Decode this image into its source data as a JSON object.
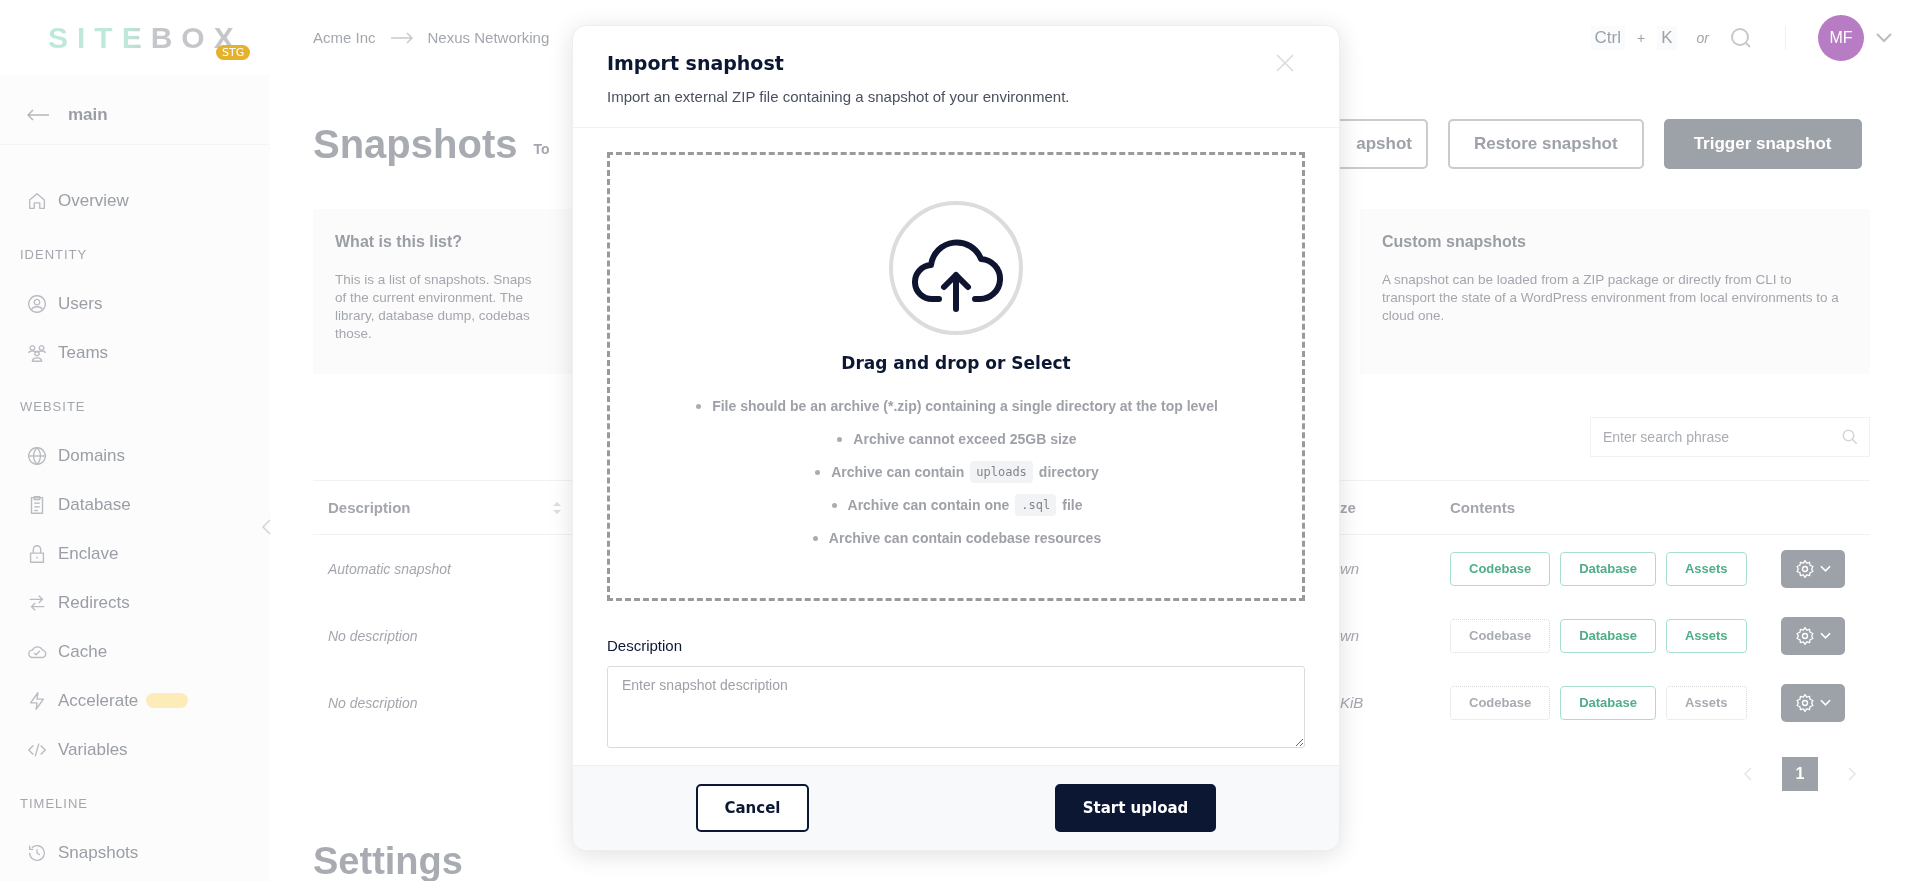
{
  "header": {
    "logo": "SITEBOX",
    "env_badge": "STG",
    "breadcrumbs": [
      "Acme Inc",
      "Nexus Networking"
    ],
    "shortcut": {
      "keys": [
        "Ctrl",
        "K"
      ],
      "plus": "+",
      "or": "or"
    },
    "avatar": "MF"
  },
  "sidebar": {
    "back": "main",
    "sections": [
      {
        "items": [
          {
            "label": "Overview"
          }
        ]
      },
      {
        "heading": "IDENTITY",
        "items": [
          {
            "label": "Users"
          },
          {
            "label": "Teams"
          }
        ]
      },
      {
        "heading": "WEBSITE",
        "items": [
          {
            "label": "Domains"
          },
          {
            "label": "Database"
          },
          {
            "label": "Enclave"
          },
          {
            "label": "Redirects"
          },
          {
            "label": "Cache"
          },
          {
            "label": "Accelerate",
            "badge": true
          },
          {
            "label": "Variables"
          }
        ]
      },
      {
        "heading": "TIMELINE",
        "items": [
          {
            "label": "Snapshots"
          }
        ]
      }
    ]
  },
  "page": {
    "title": "Snapshots",
    "title_suffix": "To",
    "actions": [
      {
        "label": "apshot",
        "kind": "outline"
      },
      {
        "label": "Restore snapshot",
        "kind": "outline"
      },
      {
        "label": "Trigger snapshot",
        "kind": "primary"
      }
    ],
    "info_card": {
      "title": "What is this list?",
      "lines": [
        "This is a list of snapshots. Snaps",
        "of the current environment. The",
        "library, database dump, codebas",
        "those."
      ]
    },
    "custom_card": {
      "title": "Custom snapshots",
      "text": "A snapshot can be loaded from a ZIP package or directly from CLI to transport the state of a WordPress environment from local environments to a cloud one."
    },
    "search": {
      "placeholder": "Enter search phrase"
    },
    "table": {
      "columns": [
        "Description",
        "ze",
        "Contents"
      ],
      "rows": [
        {
          "description": "Automatic snapshot",
          "size": "wn",
          "contents": [
            {
              "label": "Codebase",
              "included": true
            },
            {
              "label": "Database",
              "included": true
            },
            {
              "label": "Assets",
              "included": true
            }
          ]
        },
        {
          "description": "No description",
          "size": "wn",
          "contents": [
            {
              "label": "Codebase",
              "included": false
            },
            {
              "label": "Database",
              "included": true
            },
            {
              "label": "Assets",
              "included": true
            }
          ]
        },
        {
          "description": "No description",
          "size": "KiB",
          "contents": [
            {
              "label": "Codebase",
              "included": false
            },
            {
              "label": "Database",
              "included": true
            },
            {
              "label": "Assets",
              "included": false
            }
          ]
        }
      ]
    },
    "pagination": [
      {
        "label": "1",
        "selected": true
      }
    ],
    "settings_title": "Settings"
  },
  "modal": {
    "title": "Import snaphost",
    "subtitle": "Import an external ZIP file containing a snapshot of your environment.",
    "dropzone": {
      "prompt": "Drag and drop or Select",
      "rules": [
        {
          "text": "File should be an archive (*.zip) containing a single directory at the top level"
        },
        {
          "text": "Archive cannot exceed 25GB size"
        },
        {
          "text": "Archive can contain",
          "code": "uploads",
          "after": "directory"
        },
        {
          "text": "Archive can contain one",
          "code": ".sql",
          "after": "file"
        },
        {
          "text": "Archive can contain codebase resources"
        }
      ]
    },
    "description": {
      "label": "Description",
      "placeholder": "Enter snapshot description"
    },
    "buttons": [
      {
        "label": "Cancel",
        "kind": "secondary"
      },
      {
        "label": "Start upload",
        "kind": "primary"
      }
    ]
  }
}
